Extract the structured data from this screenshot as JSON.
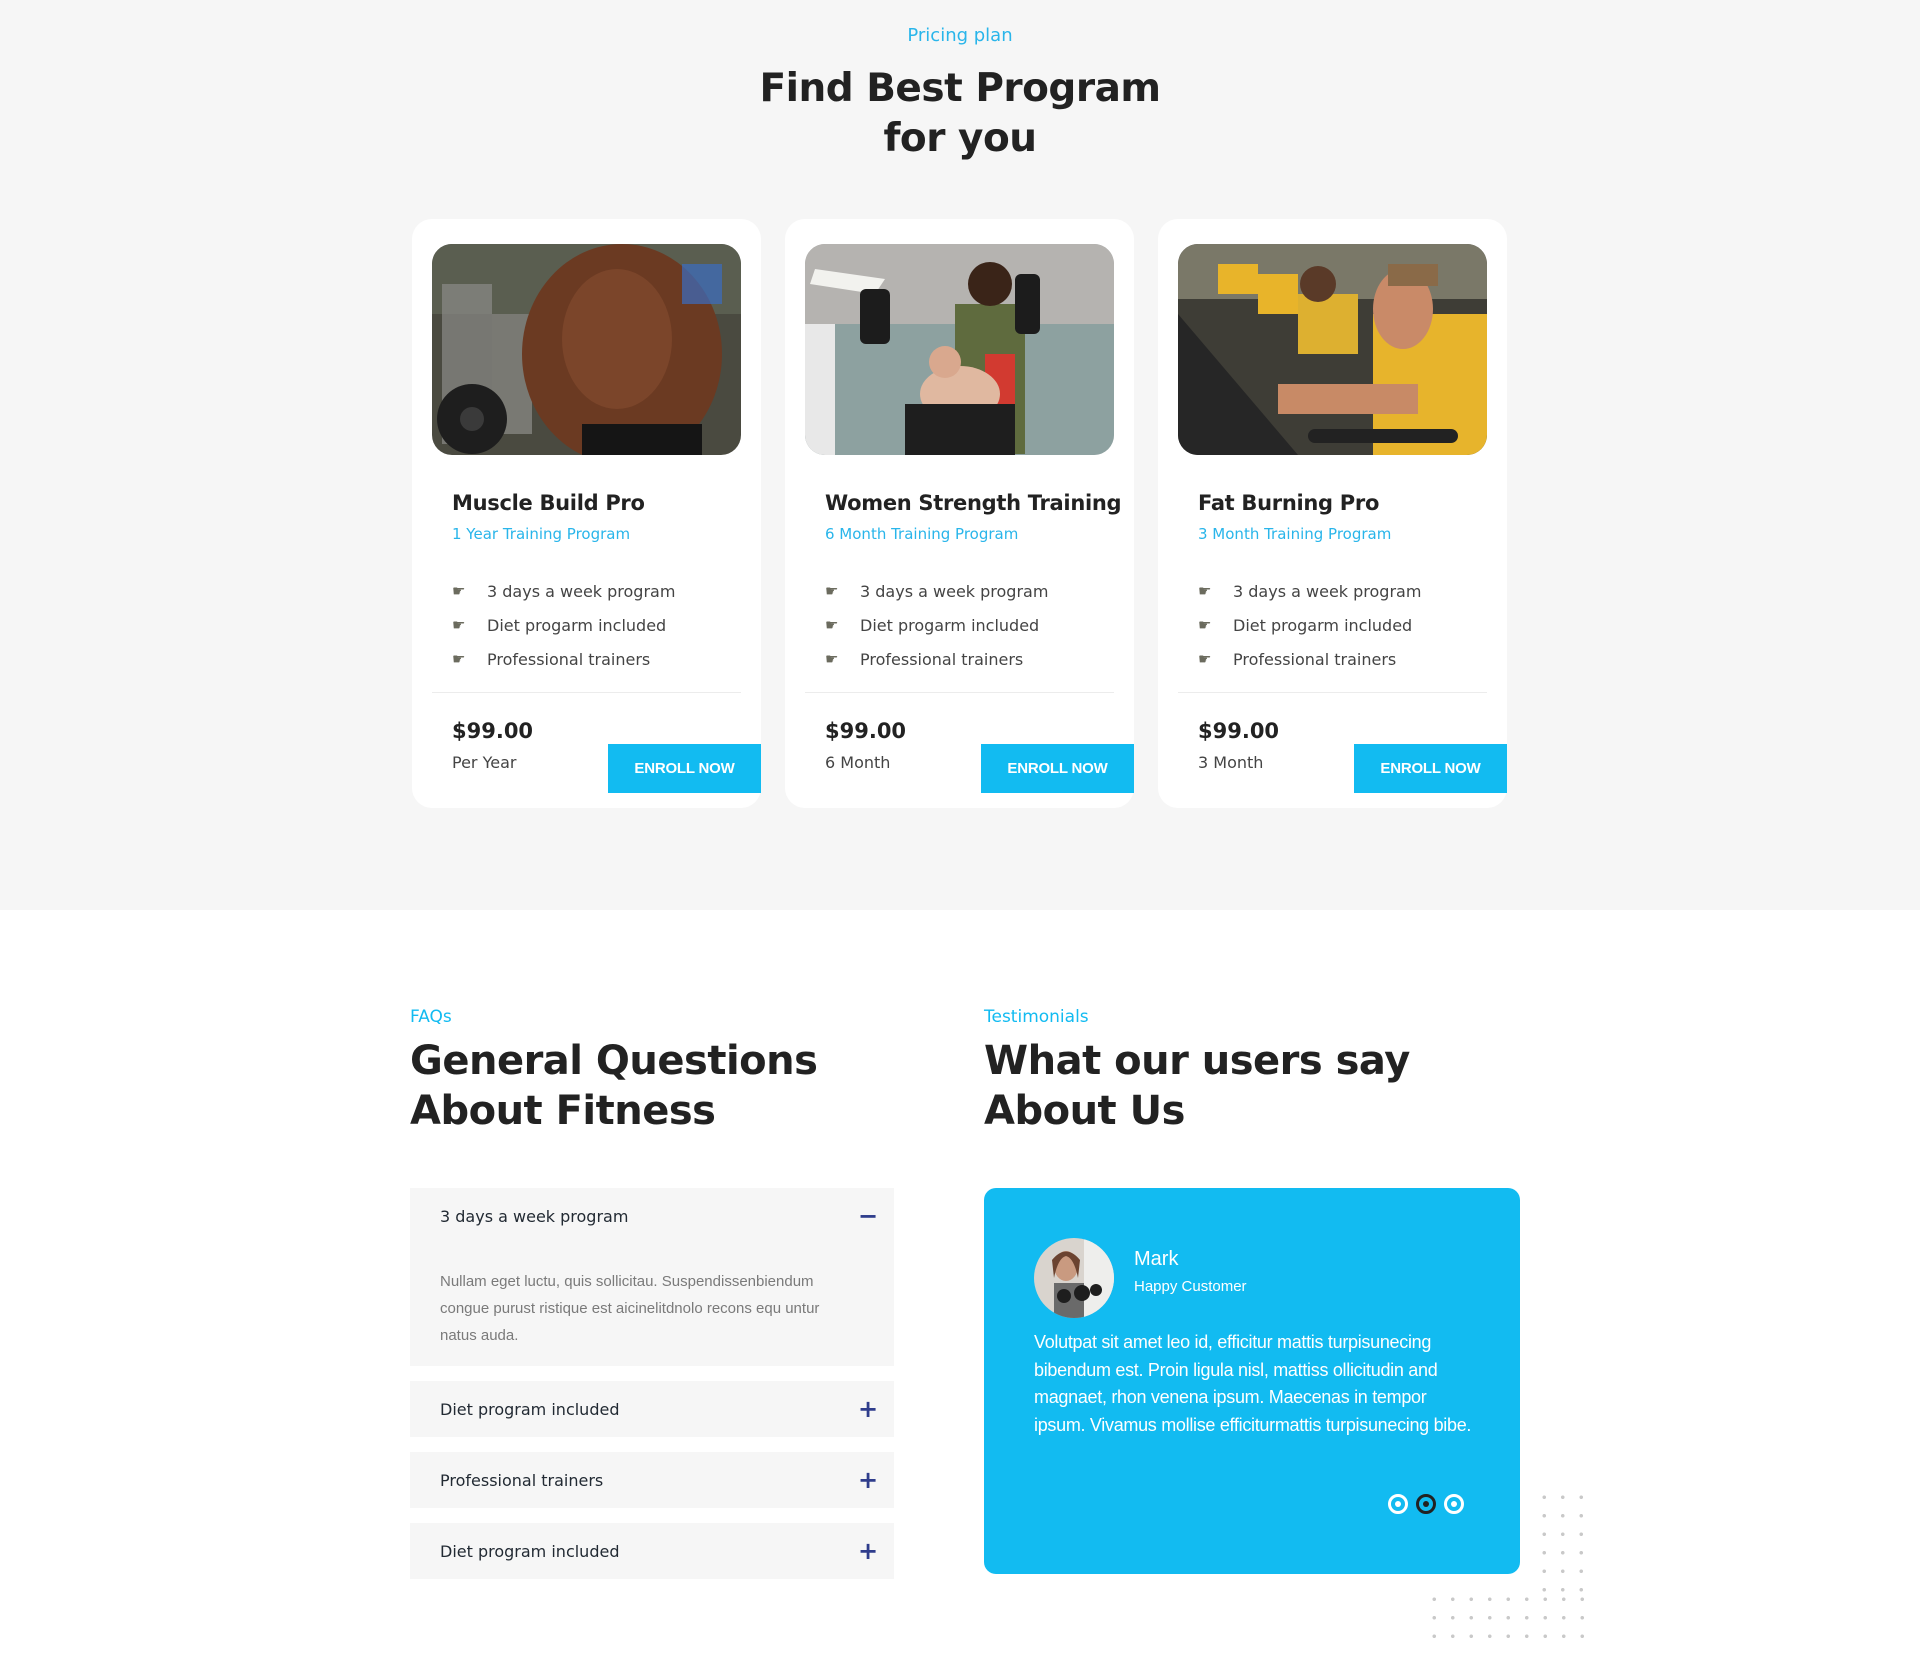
{
  "pricing": {
    "eyebrow": "Pricing plan",
    "title_line1": "Find Best Program",
    "title_line2": "for you",
    "plans": [
      {
        "name": "Muscle Build Pro",
        "subtitle": "1 Year Training Program",
        "image": "bodybuilder-gym-photo",
        "features": [
          "3 days a week program",
          "Diet progarm included",
          "Professional trainers"
        ],
        "price": "$99.00",
        "period": "Per Year",
        "button": "ENROLL NOW"
      },
      {
        "name": "Women Strength Training",
        "subtitle": "6 Month Training Program",
        "image": "woman-dumbbell-press-photo",
        "features": [
          "3 days a week program",
          "Diet progarm included",
          "Professional trainers"
        ],
        "price": "$99.00",
        "period": "6 Month",
        "button": "ENROLL NOW"
      },
      {
        "name": "Fat Burning Pro",
        "subtitle": "3 Month Training Program",
        "image": "group-cycling-photo",
        "features": [
          "3 days a week program",
          "Diet progarm included",
          "Professional trainers"
        ],
        "price": "$99.00",
        "period": "3 Month",
        "button": "ENROLL NOW"
      }
    ],
    "feature_icon": "pointing-hand-icon"
  },
  "faq": {
    "eyebrow": "FAQs",
    "title_line1": "General Questions",
    "title_line2": "About Fitness",
    "items": [
      {
        "question": "3 days a week program",
        "expanded": true,
        "toggle": "−",
        "answer": "Nullam eget luctu, quis sollicitau. Suspendissenbiendum congue purust ristique est aicinelitdnolo recons equ untur natus auda."
      },
      {
        "question": "Diet program included",
        "expanded": false,
        "toggle": "+"
      },
      {
        "question": "Professional trainers",
        "expanded": false,
        "toggle": "+"
      },
      {
        "question": "Diet program included",
        "expanded": false,
        "toggle": "+"
      }
    ]
  },
  "testimonials": {
    "eyebrow": "Testimonials",
    "title_line1": "What our users say",
    "title_line2": "About Us",
    "current": {
      "name": "Mark",
      "role": "Happy Customer",
      "quote": "Volutpat sit amet leo id, efficitur mattis turpisunecing bibendum est. Proin ligula nisl, mattiss ollicitudin and magnaet, rhon venena ipsum. Maecenas in tempor ipsum. Vivamus mollise efficiturmattis turpisunecing bibe."
    },
    "slides_count": 3,
    "active_slide": 2
  },
  "colors": {
    "accent": "#12bbf1",
    "section_bg": "#f6f6f6",
    "heading": "#222222",
    "faq_toggle": "#2f3d8c"
  }
}
